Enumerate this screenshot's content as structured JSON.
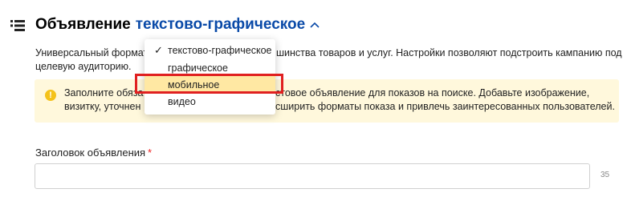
{
  "header": {
    "ad_label": "Объявление",
    "ad_type": "текстово-графическое"
  },
  "description": {
    "part1": "Универсальный формат -",
    "part2": "шинства товаров и услуг. Настройки позволяют подстроить кампанию под",
    "part3": "целевую аудиторию."
  },
  "notice": {
    "line1a": "Заполните обяза",
    "line1b": "стовое объявление для показов на поиске. Добавьте изображение,",
    "line2a": "визитку, уточнен",
    "line2b": "сширить форматы показа и привлечь заинтересованных пользователей."
  },
  "dropdown": {
    "items": [
      {
        "label": "текстово-графическое",
        "checked": true
      },
      {
        "label": "графическое",
        "checked": false
      },
      {
        "label": "мобильное",
        "checked": false,
        "hovered": true
      },
      {
        "label": "видео",
        "checked": false
      }
    ]
  },
  "field": {
    "label": "Заголовок объявления",
    "required_mark": "*",
    "value": "",
    "counter": "35"
  },
  "colors": {
    "accent": "#0a4aa8",
    "notice_bg": "#fff8dc",
    "hover_bg": "#ffe8a3",
    "highlight": "#e02020"
  }
}
